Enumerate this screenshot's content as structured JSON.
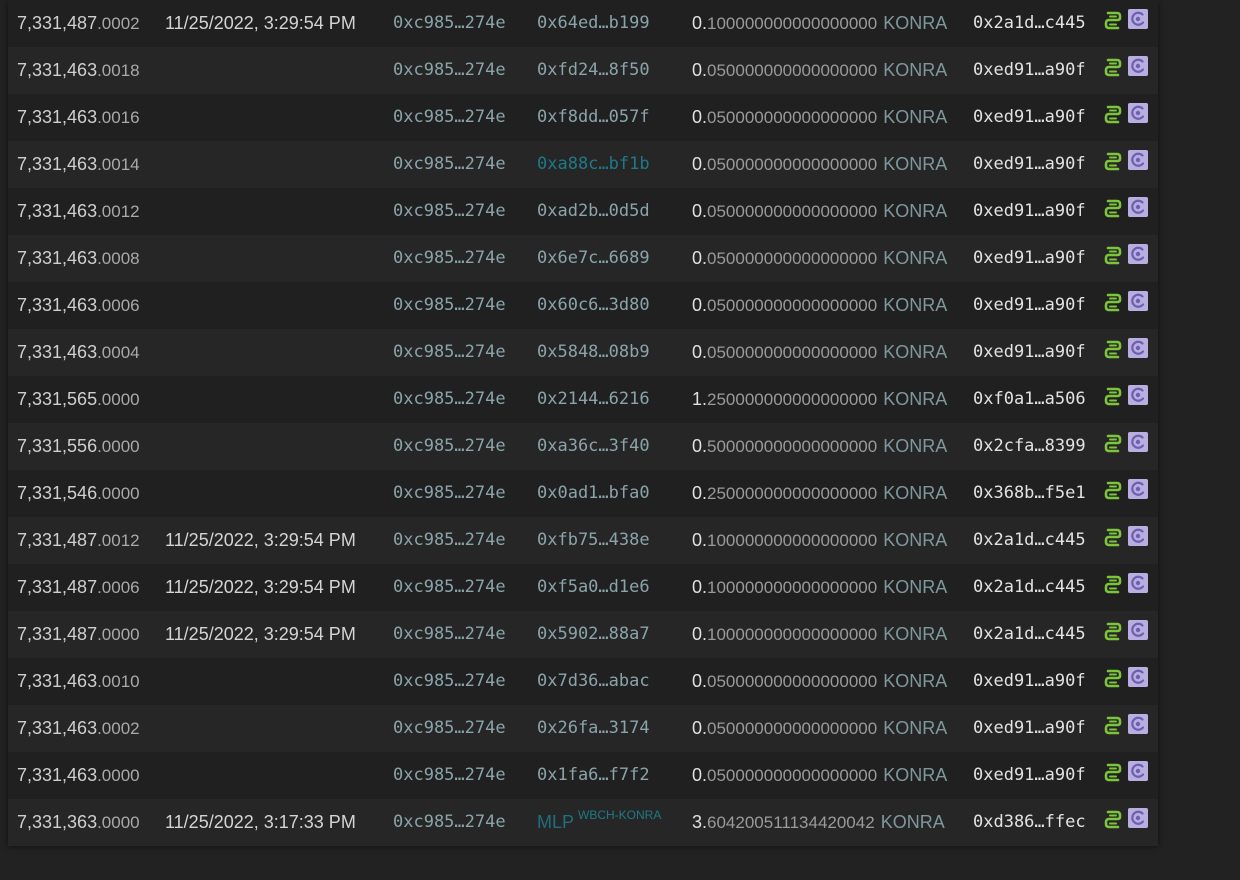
{
  "theme": {
    "background": "#222222",
    "panel": "#1e1e1e",
    "row_odd": "#202020",
    "row_even": "#262626",
    "hash_color": "#8aa4aa",
    "link_color": "#1e7a88",
    "token_color": "#7f989c",
    "chain_icon_color": "#7cc43a",
    "token_icon_color": "#b9aee0"
  },
  "icons": {
    "chain": "smartbch-chain-icon",
    "token": "konra-token-icon"
  },
  "rows": [
    {
      "block": "7,331,487",
      "block_frac": ".0002",
      "time": "11/25/2022, 3:29:54 PM",
      "from": "0xc985…274e",
      "to": "0x64ed…b199",
      "to_style": "hash",
      "to_sub": "",
      "amount_whole": "0.",
      "amount_dec": "100000000000000000",
      "token": "KONRA",
      "tx": "0x2a1d…c445"
    },
    {
      "block": "7,331,463",
      "block_frac": ".0018",
      "time": "",
      "from": "0xc985…274e",
      "to": "0xfd24…8f50",
      "to_style": "hash",
      "to_sub": "",
      "amount_whole": "0.",
      "amount_dec": "050000000000000000",
      "token": "KONRA",
      "tx": "0xed91…a90f"
    },
    {
      "block": "7,331,463",
      "block_frac": ".0016",
      "time": "",
      "from": "0xc985…274e",
      "to": "0xf8dd…057f",
      "to_style": "hash",
      "to_sub": "",
      "amount_whole": "0.",
      "amount_dec": "050000000000000000",
      "token": "KONRA",
      "tx": "0xed91…a90f"
    },
    {
      "block": "7,331,463",
      "block_frac": ".0014",
      "time": "",
      "from": "0xc985…274e",
      "to": "0xa88c…bf1b",
      "to_style": "link",
      "to_sub": "",
      "amount_whole": "0.",
      "amount_dec": "050000000000000000",
      "token": "KONRA",
      "tx": "0xed91…a90f"
    },
    {
      "block": "7,331,463",
      "block_frac": ".0012",
      "time": "",
      "from": "0xc985…274e",
      "to": "0xad2b…0d5d",
      "to_style": "hash",
      "to_sub": "",
      "amount_whole": "0.",
      "amount_dec": "050000000000000000",
      "token": "KONRA",
      "tx": "0xed91…a90f"
    },
    {
      "block": "7,331,463",
      "block_frac": ".0008",
      "time": "",
      "from": "0xc985…274e",
      "to": "0x6e7c…6689",
      "to_style": "hash",
      "to_sub": "",
      "amount_whole": "0.",
      "amount_dec": "050000000000000000",
      "token": "KONRA",
      "tx": "0xed91…a90f"
    },
    {
      "block": "7,331,463",
      "block_frac": ".0006",
      "time": "",
      "from": "0xc985…274e",
      "to": "0x60c6…3d80",
      "to_style": "hash",
      "to_sub": "",
      "amount_whole": "0.",
      "amount_dec": "050000000000000000",
      "token": "KONRA",
      "tx": "0xed91…a90f"
    },
    {
      "block": "7,331,463",
      "block_frac": ".0004",
      "time": "",
      "from": "0xc985…274e",
      "to": "0x5848…08b9",
      "to_style": "hash",
      "to_sub": "",
      "amount_whole": "0.",
      "amount_dec": "050000000000000000",
      "token": "KONRA",
      "tx": "0xed91…a90f"
    },
    {
      "block": "7,331,565",
      "block_frac": ".0000",
      "time": "",
      "from": "0xc985…274e",
      "to": "0x2144…6216",
      "to_style": "hash",
      "to_sub": "",
      "amount_whole": "1.",
      "amount_dec": "250000000000000000",
      "token": "KONRA",
      "tx": "0xf0a1…a506"
    },
    {
      "block": "7,331,556",
      "block_frac": ".0000",
      "time": "",
      "from": "0xc985…274e",
      "to": "0xa36c…3f40",
      "to_style": "hash",
      "to_sub": "",
      "amount_whole": "0.",
      "amount_dec": "500000000000000000",
      "token": "KONRA",
      "tx": "0x2cfa…8399"
    },
    {
      "block": "7,331,546",
      "block_frac": ".0000",
      "time": "",
      "from": "0xc985…274e",
      "to": "0x0ad1…bfa0",
      "to_style": "hash",
      "to_sub": "",
      "amount_whole": "0.",
      "amount_dec": "250000000000000000",
      "token": "KONRA",
      "tx": "0x368b…f5e1"
    },
    {
      "block": "7,331,487",
      "block_frac": ".0012",
      "time": "11/25/2022, 3:29:54 PM",
      "from": "0xc985…274e",
      "to": "0xfb75…438e",
      "to_style": "hash",
      "to_sub": "",
      "amount_whole": "0.",
      "amount_dec": "100000000000000000",
      "token": "KONRA",
      "tx": "0x2a1d…c445"
    },
    {
      "block": "7,331,487",
      "block_frac": ".0006",
      "time": "11/25/2022, 3:29:54 PM",
      "from": "0xc985…274e",
      "to": "0xf5a0…d1e6",
      "to_style": "hash",
      "to_sub": "",
      "amount_whole": "0.",
      "amount_dec": "100000000000000000",
      "token": "KONRA",
      "tx": "0x2a1d…c445"
    },
    {
      "block": "7,331,487",
      "block_frac": ".0000",
      "time": "11/25/2022, 3:29:54 PM",
      "from": "0xc985…274e",
      "to": "0x5902…88a7",
      "to_style": "hash",
      "to_sub": "",
      "amount_whole": "0.",
      "amount_dec": "100000000000000000",
      "token": "KONRA",
      "tx": "0x2a1d…c445"
    },
    {
      "block": "7,331,463",
      "block_frac": ".0010",
      "time": "",
      "from": "0xc985…274e",
      "to": "0x7d36…abac",
      "to_style": "hash",
      "to_sub": "",
      "amount_whole": "0.",
      "amount_dec": "050000000000000000",
      "token": "KONRA",
      "tx": "0xed91…a90f"
    },
    {
      "block": "7,331,463",
      "block_frac": ".0002",
      "time": "",
      "from": "0xc985…274e",
      "to": "0x26fa…3174",
      "to_style": "hash",
      "to_sub": "",
      "amount_whole": "0.",
      "amount_dec": "050000000000000000",
      "token": "KONRA",
      "tx": "0xed91…a90f"
    },
    {
      "block": "7,331,463",
      "block_frac": ".0000",
      "time": "",
      "from": "0xc985…274e",
      "to": "0x1fa6…f7f2",
      "to_style": "hash",
      "to_sub": "",
      "amount_whole": "0.",
      "amount_dec": "050000000000000000",
      "token": "KONRA",
      "tx": "0xed91…a90f"
    },
    {
      "block": "7,331,363",
      "block_frac": ".0000",
      "time": "11/25/2022, 3:17:33 PM",
      "from": "0xc985…274e",
      "to": "MLP",
      "to_style": "lp",
      "to_sub": "WBCH-KONRA",
      "amount_whole": "3.",
      "amount_dec": "604200511134420042",
      "token": "KONRA",
      "tx": "0xd386…ffec"
    }
  ]
}
